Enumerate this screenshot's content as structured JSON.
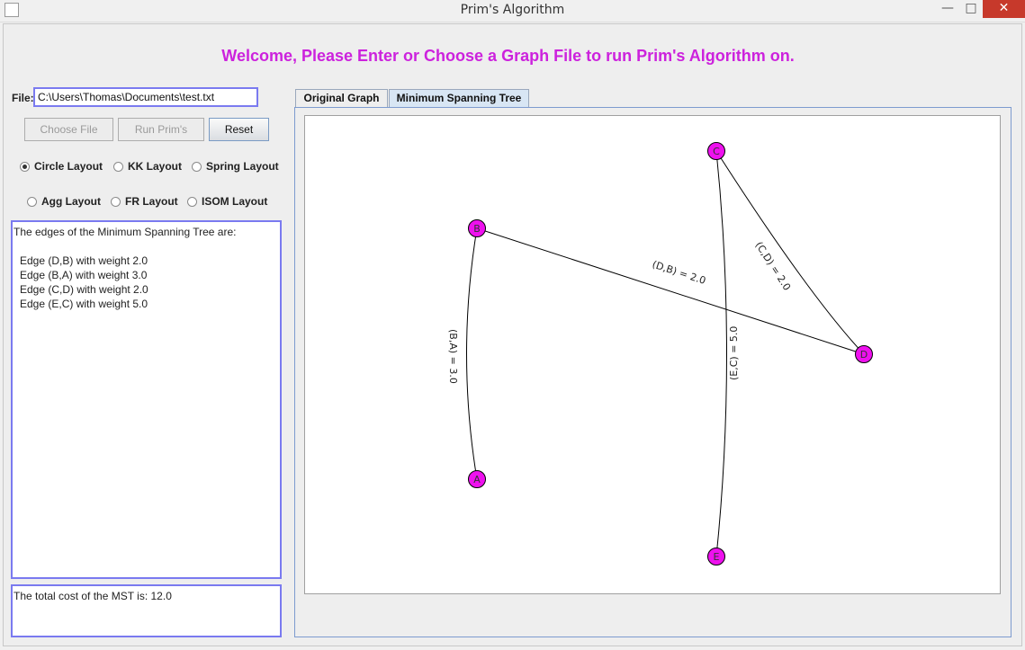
{
  "window": {
    "title": "Prim's Algorithm",
    "minimize": "—",
    "maximize": "□",
    "close": "✕"
  },
  "welcome": "Welcome, Please Enter or Choose a Graph File to run Prim's Algorithm on.",
  "file": {
    "label": "File:",
    "value": "C:\\Users\\Thomas\\Documents\\test.txt"
  },
  "buttons": {
    "choose": "Choose File",
    "run": "Run Prim's",
    "reset": "Reset"
  },
  "layouts": {
    "circle": {
      "label": "Circle Layout",
      "selected": true
    },
    "kk": {
      "label": "KK Layout",
      "selected": false
    },
    "spring": {
      "label": "Spring Layout",
      "selected": false
    },
    "agg": {
      "label": "Agg Layout",
      "selected": false
    },
    "fr": {
      "label": "FR Layout",
      "selected": false
    },
    "isom": {
      "label": "ISOM Layout",
      "selected": false
    }
  },
  "output": {
    "header": "The edges of the Minimum Spanning Tree are:",
    "edges": [
      "Edge (D,B) with weight 2.0",
      "Edge (B,A) with weight 3.0",
      "Edge (C,D) with weight 2.0",
      "Edge (E,C) with weight 5.0"
    ],
    "total": "The total cost of the MST is: 12.0"
  },
  "tabs": {
    "original": "Original Graph",
    "mst": "Minimum Spanning Tree",
    "active": "mst"
  },
  "graph": {
    "node_color": "#ee11ee",
    "nodes": [
      "A",
      "B",
      "C",
      "D",
      "E"
    ],
    "edge_labels": {
      "db": "(D,B) = 2.0",
      "ba": "(B,A) = 3.0",
      "cd": "(C,D) = 2.0",
      "ec": "(E,C) = 5.0"
    }
  }
}
